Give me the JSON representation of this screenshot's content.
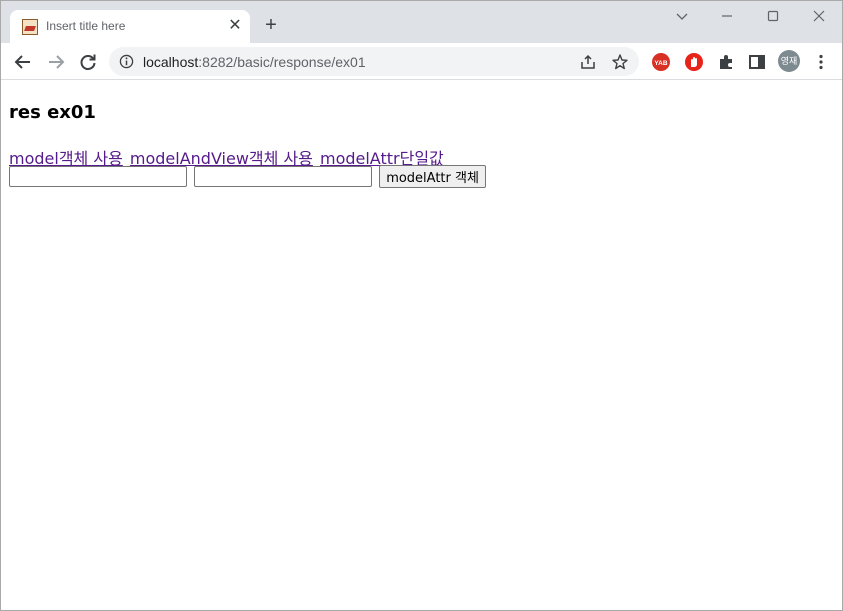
{
  "browser": {
    "tab": {
      "title": "Insert title here"
    },
    "address": {
      "host": "localhost",
      "path": ":8282/basic/response/ex01"
    },
    "profile": {
      "initials": "영재"
    },
    "icons": {
      "back": "arrow-left-icon",
      "forward": "arrow-right-icon",
      "reload": "reload-icon",
      "site_info": "info-icon",
      "share": "share-icon",
      "bookmark": "star-icon",
      "ext1": "yab-extension-icon",
      "ext2": "adblock-extension-icon",
      "ext3": "puzzle-extensions-icon",
      "side_panel": "side-panel-icon",
      "menu": "kebab-menu-icon"
    },
    "colors": {
      "tabstrip": "#dee1e6",
      "omnibox": "#f1f3f4",
      "visited_link": "#551a8b"
    }
  },
  "page": {
    "heading": "res ex01",
    "links": [
      {
        "label": "model객체 사용"
      },
      {
        "label": "modelAndView객체 사용"
      },
      {
        "label": "modelAttr단일값"
      }
    ],
    "form": {
      "field1_value": "",
      "field2_value": "",
      "submit_label": "modelAttr 객체"
    }
  }
}
